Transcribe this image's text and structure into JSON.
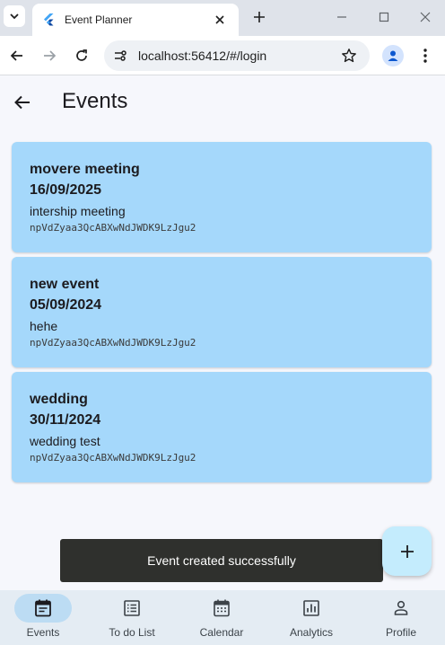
{
  "browser": {
    "tab_title": "Event Planner",
    "url": "localhost:56412/#/login"
  },
  "app": {
    "page_title": "Events",
    "events": [
      {
        "name": "movere meeting",
        "date": "16/09/2025",
        "description": "intership meeting",
        "uid": "npVdZyaa3QcABXwNdJWDK9LzJgu2"
      },
      {
        "name": "new event",
        "date": "05/09/2024",
        "description": "hehe",
        "uid": "npVdZyaa3QcABXwNdJWDK9LzJgu2"
      },
      {
        "name": "wedding",
        "date": "30/11/2024",
        "description": "wedding test",
        "uid": "npVdZyaa3QcABXwNdJWDK9LzJgu2"
      }
    ],
    "snackbar": "Event created successfully",
    "nav": [
      {
        "label": "Events",
        "icon": "events-icon",
        "active": true
      },
      {
        "label": "To do List",
        "icon": "todo-list-icon",
        "active": false
      },
      {
        "label": "Calendar",
        "icon": "calendar-icon",
        "active": false
      },
      {
        "label": "Analytics",
        "icon": "analytics-icon",
        "active": false
      },
      {
        "label": "Profile",
        "icon": "profile-icon",
        "active": false
      }
    ]
  },
  "colors": {
    "card": "#a5d8fb",
    "fab": "#c4ecfd",
    "bottom_nav": "#e4ecf3",
    "active_pill": "#bcdcf3",
    "snackbar": "#2f302d"
  }
}
